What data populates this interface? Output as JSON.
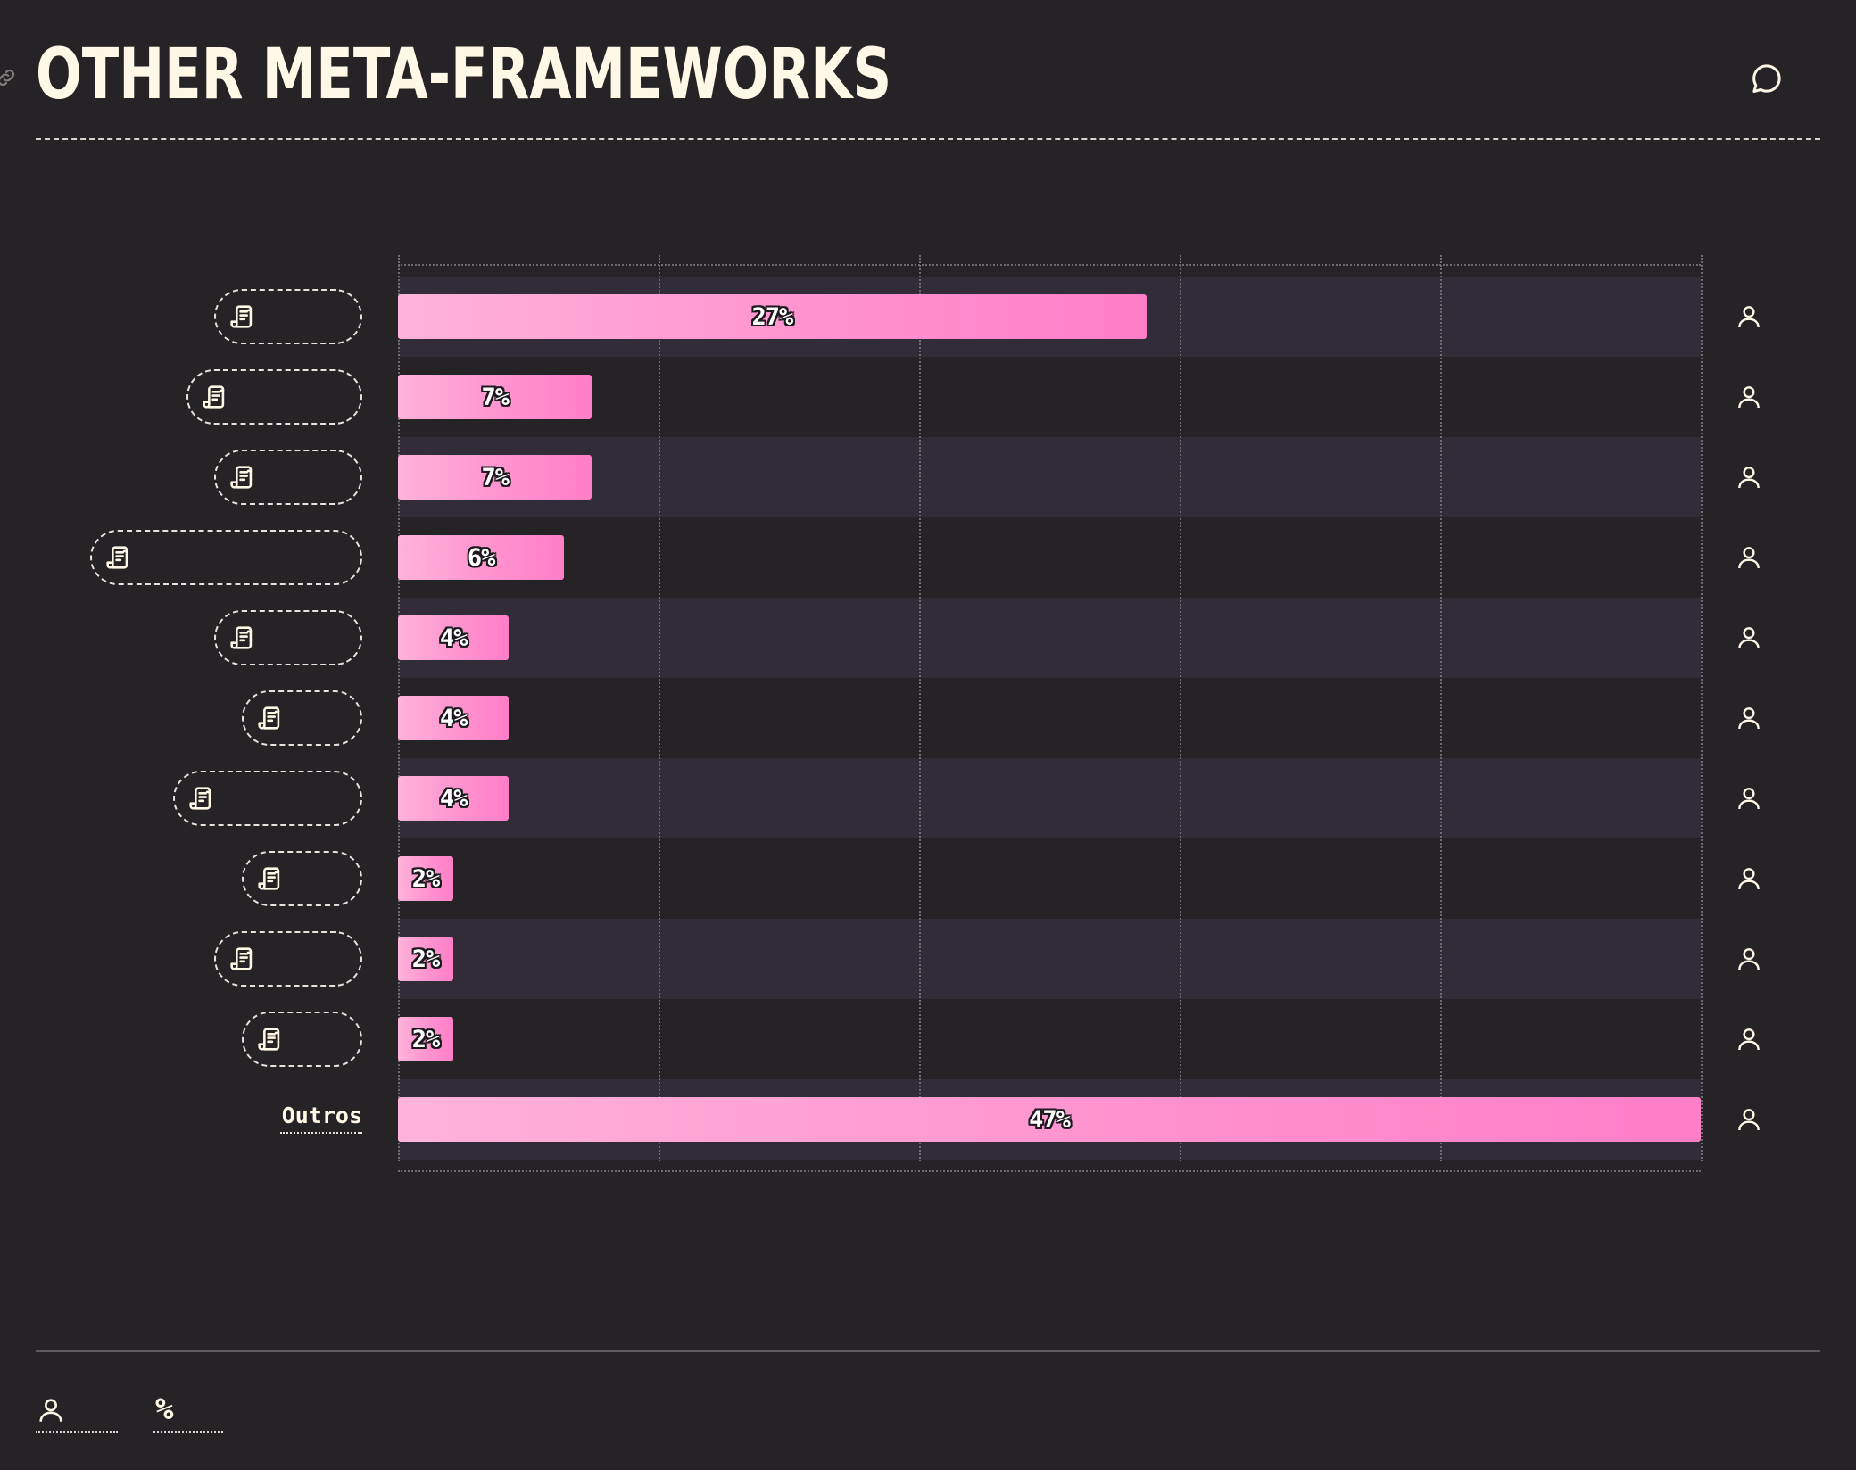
{
  "header": {
    "title": "OTHER META-FRAMEWORKS"
  },
  "colors": {
    "background": "#252326",
    "bar_start": "#ffb3da",
    "bar_end": "#ff7ec8",
    "band_alt": "#312c38",
    "text": "#fff8e7"
  },
  "icons": {
    "anchor": "link-icon",
    "comment": "comment-icon",
    "row_item": "scroll-icon",
    "count": "user-icon",
    "footer_count": "user-icon",
    "footer_percent": "percent-icon"
  },
  "footer": {
    "percent_symbol": "%"
  },
  "chart_data": {
    "type": "bar",
    "orientation": "horizontal",
    "categories": [
      "",
      "",
      "",
      "",
      "",
      "",
      "",
      "",
      "",
      "",
      "Outros"
    ],
    "values": [
      27,
      7,
      7,
      6,
      4,
      4,
      4,
      2,
      2,
      2,
      47
    ],
    "value_labels": [
      "27%",
      "7%",
      "7%",
      "6%",
      "4%",
      "4%",
      "4%",
      "2%",
      "2%",
      "2%",
      "47%"
    ],
    "unit": "%",
    "xlim": [
      0,
      47
    ],
    "grid": true,
    "gridline_count": 6
  }
}
